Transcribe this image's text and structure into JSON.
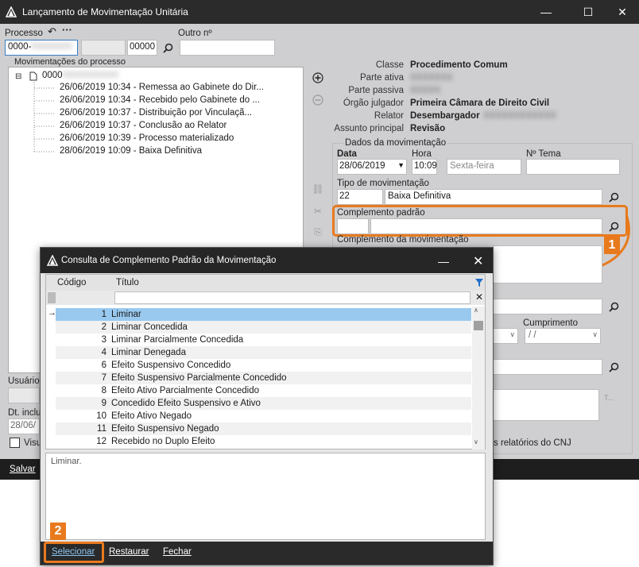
{
  "window": {
    "title": "Lançamento de Movimentação Unitária",
    "minimize": "—",
    "maximize": "☐",
    "close": "✕"
  },
  "processo": {
    "label": "Processo",
    "number_prefix": "0000-",
    "number_end": "00000",
    "outro_label": "Outro nº"
  },
  "tree": {
    "group_label": "Movimentações do processo",
    "root": "0000",
    "items": [
      "26/06/2019 10:34 - Remessa ao Gabinete do Dir...",
      "26/06/2019 10:34 - Recebido pelo Gabinete do ...",
      "26/06/2019 10:37 - Distribuição por Vinculaçã...",
      "26/06/2019 10:37 - Conclusão ao Relator",
      "26/06/2019 10:39 - Processo materializado",
      "28/06/2019 10:09 - Baixa Definitiva"
    ]
  },
  "info": {
    "classe_label": "Classe",
    "classe_value": "Procedimento Comum",
    "parte_ativa_label": "Parte ativa",
    "parte_passiva_label": "Parte passiva",
    "orgao_label": "Órgão julgador",
    "orgao_value": "Primeira Câmara de Direito Civil",
    "relator_label": "Relator",
    "relator_value": "Desembargador",
    "assunto_label": "Assunto principal",
    "assunto_value": "Revisão"
  },
  "dados": {
    "group_label": "Dados da movimentação",
    "data_label": "Data",
    "data_value": "28/06/2019",
    "hora_label": "Hora",
    "hora_value": "10:09",
    "weekday": "Sexta-feira",
    "tema_label": "Nº Tema",
    "tipo_label": "Tipo de movimentação",
    "tipo_code": "22",
    "tipo_value": "Baixa Definitiva",
    "complemento_padrao_label": "Complemento padrão",
    "complemento_mov_label": "Complemento da movimentação",
    "cumprimento_label": "Cumprimento",
    "cumprimento_value": "/ /",
    "cnj_text": "s relatórios do CNJ"
  },
  "left_bottom": {
    "usuario_label": "Usuário",
    "dt_label": "Dt. inclu",
    "dt_value": "28/06/",
    "visu_label": "Visu"
  },
  "bottombar": {
    "salvar": "Salvar"
  },
  "dialog": {
    "title": "Consulta de Complemento Padrão da Movimentação",
    "col_codigo": "Código",
    "col_titulo": "Título",
    "rows": [
      {
        "cod": "1",
        "titulo": "Liminar"
      },
      {
        "cod": "2",
        "titulo": "Liminar Concedida"
      },
      {
        "cod": "3",
        "titulo": "Liminar Parcialmente Concedida"
      },
      {
        "cod": "4",
        "titulo": "Liminar Denegada"
      },
      {
        "cod": "6",
        "titulo": "Efeito Suspensivo Concedido"
      },
      {
        "cod": "7",
        "titulo": "Efeito Suspensivo Parcialmente Concedido"
      },
      {
        "cod": "8",
        "titulo": "Efeito Ativo Parcialmente Concedido"
      },
      {
        "cod": "9",
        "titulo": "Concedido Efeito Suspensivo e Ativo"
      },
      {
        "cod": "10",
        "titulo": "Efeito Ativo Negado"
      },
      {
        "cod": "11",
        "titulo": "Efeito Suspensivo Negado"
      },
      {
        "cod": "12",
        "titulo": "Recebido no Duplo Efeito"
      }
    ],
    "preview": "Liminar.",
    "btn_selecionar": "Selecionar",
    "btn_restaurar": "Restaurar",
    "btn_fechar": "Fechar",
    "close": "✕"
  },
  "callouts": {
    "one": "1",
    "two": "2"
  },
  "colors": {
    "accent": "#e87a1d",
    "selection": "#99c9ef",
    "titlebar": "#2b2b2b"
  }
}
